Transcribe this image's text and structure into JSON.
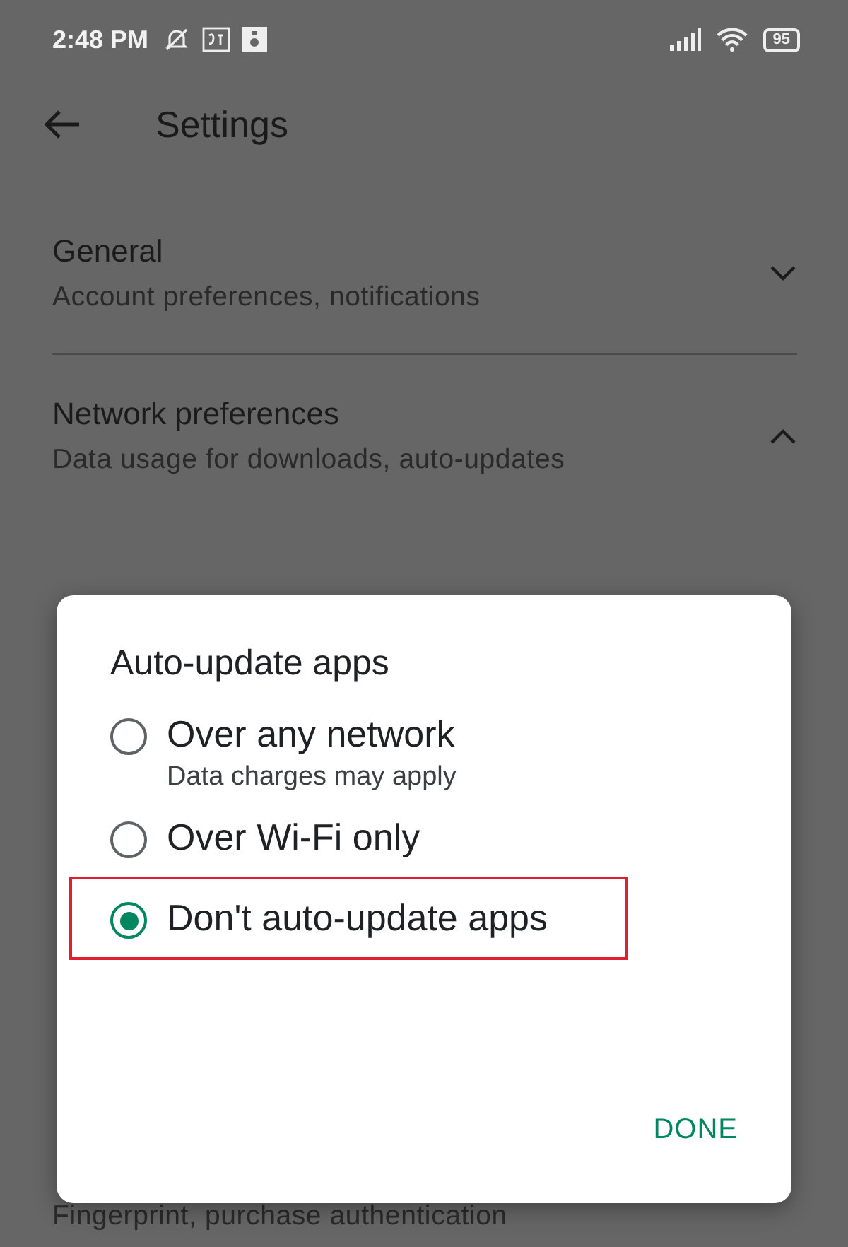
{
  "status_bar": {
    "time": "2:48 PM",
    "battery": "95"
  },
  "app_bar": {
    "title": "Settings"
  },
  "sections": [
    {
      "title": "General",
      "subtitle": "Account preferences, notifications",
      "expanded": false
    },
    {
      "title": "Network preferences",
      "subtitle": "Data usage for downloads, auto-updates",
      "expanded": true
    }
  ],
  "footer_subtitle": "Fingerprint, purchase authentication",
  "dialog": {
    "title": "Auto-update apps",
    "options": [
      {
        "label": "Over any network",
        "subtitle": "Data charges may apply",
        "selected": false,
        "highlighted": false
      },
      {
        "label": "Over Wi-Fi only",
        "selected": false,
        "highlighted": false
      },
      {
        "label": "Don't auto-update apps",
        "selected": true,
        "highlighted": true
      }
    ],
    "button": "DONE"
  }
}
